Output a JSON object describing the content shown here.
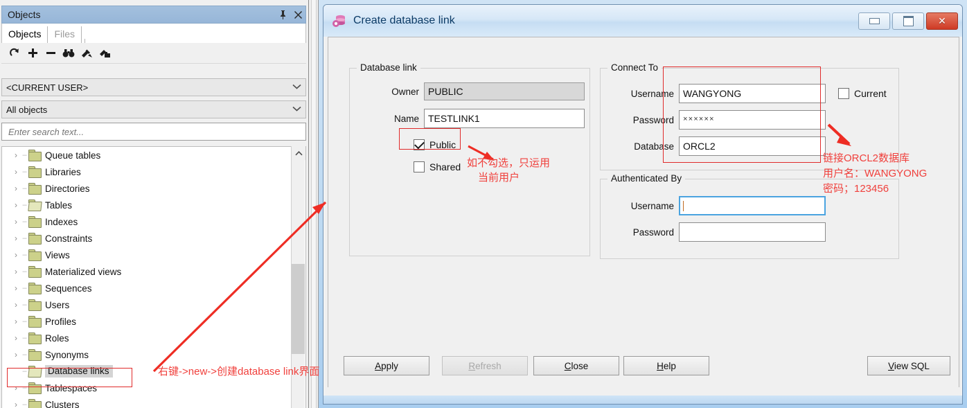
{
  "objects_panel": {
    "title": "Objects",
    "pin_icon": "pin-icon",
    "close_icon": "close-icon",
    "tabs": [
      {
        "label": "Objects",
        "active": true
      },
      {
        "label": "Files",
        "active": false
      }
    ],
    "toolbar_icons": [
      {
        "name": "refresh-icon",
        "glyph": "↻"
      },
      {
        "name": "add-icon",
        "glyph": "✚"
      },
      {
        "name": "remove-icon",
        "glyph": "➖"
      },
      {
        "name": "find-icon",
        "glyph": "🔍"
      },
      {
        "name": "filter-icon",
        "glyph": "⚒"
      },
      {
        "name": "folder-tool-icon",
        "glyph": "⚙"
      }
    ],
    "user_filter": "<CURRENT USER>",
    "object_filter": "All objects",
    "search_placeholder": "Enter search text...",
    "search_value": "",
    "tree_items": [
      {
        "label": "Queue tables",
        "open": false,
        "selected": false
      },
      {
        "label": "Libraries",
        "open": false,
        "selected": false
      },
      {
        "label": "Directories",
        "open": false,
        "selected": false
      },
      {
        "label": "Tables",
        "open": true,
        "selected": false
      },
      {
        "label": "Indexes",
        "open": false,
        "selected": false
      },
      {
        "label": "Constraints",
        "open": false,
        "selected": false
      },
      {
        "label": "Views",
        "open": false,
        "selected": false
      },
      {
        "label": "Materialized views",
        "open": false,
        "selected": false
      },
      {
        "label": "Sequences",
        "open": false,
        "selected": false
      },
      {
        "label": "Users",
        "open": false,
        "selected": false
      },
      {
        "label": "Profiles",
        "open": false,
        "selected": false
      },
      {
        "label": "Roles",
        "open": false,
        "selected": false
      },
      {
        "label": "Synonyms",
        "open": false,
        "selected": false
      },
      {
        "label": "Database links",
        "open": true,
        "selected": true
      },
      {
        "label": "Tablespaces",
        "open": false,
        "selected": false
      },
      {
        "label": "Clusters",
        "open": false,
        "selected": false
      }
    ]
  },
  "dialog": {
    "title": "Create database link",
    "icon": "database-link-icon",
    "window_buttons": [
      {
        "name": "minimize-button",
        "label": "minimize"
      },
      {
        "name": "maximize-button",
        "label": "maximize"
      },
      {
        "name": "close-button",
        "label": "✕"
      }
    ],
    "database_link": {
      "legend": "Database link",
      "owner_label": "Owner",
      "owner_value": "PUBLIC",
      "name_label": "Name",
      "name_value": "TESTLINK1",
      "public_label": "Public",
      "public_checked": true,
      "shared_label": "Shared",
      "shared_checked": false
    },
    "connect_to": {
      "legend": "Connect To",
      "username_label": "Username",
      "username_value": "WANGYONG",
      "password_label": "Password",
      "password_value": "××××××",
      "database_label": "Database",
      "database_value": "ORCL2",
      "current_label": "Current",
      "current_checked": false
    },
    "authenticated_by": {
      "legend": "Authenticated By",
      "username_label": "Username",
      "username_value": "",
      "password_label": "Password",
      "password_value": ""
    },
    "buttons": [
      {
        "name": "apply-button",
        "pre": "A",
        "key": "A",
        "post": "pply",
        "label": "Apply",
        "disabled": false
      },
      {
        "name": "refresh-button",
        "pre": "R",
        "key": "R",
        "post": "efresh",
        "label": "Refresh",
        "disabled": true
      },
      {
        "name": "close-button-footer",
        "pre": "C",
        "key": "C",
        "post": "lose",
        "label": "Close",
        "disabled": false
      },
      {
        "name": "help-button",
        "pre": "H",
        "key": "H",
        "post": "elp",
        "label": "Help",
        "disabled": false
      },
      {
        "name": "view-sql-button",
        "pre": "V",
        "key": "V",
        "post": "iew SQL",
        "label": "View SQL",
        "disabled": false
      }
    ]
  },
  "annotations": {
    "tree_note": "右键->new->创建database link界面",
    "shared_note_line1": "如不勾选，只运用",
    "shared_note_line2": "当前用户",
    "connect_note_line1": "链接ORCL2数据库",
    "connect_note_line2": "用户名：WANGYONG",
    "connect_note_line3": "密码；123456",
    "color": "#f0403c"
  }
}
